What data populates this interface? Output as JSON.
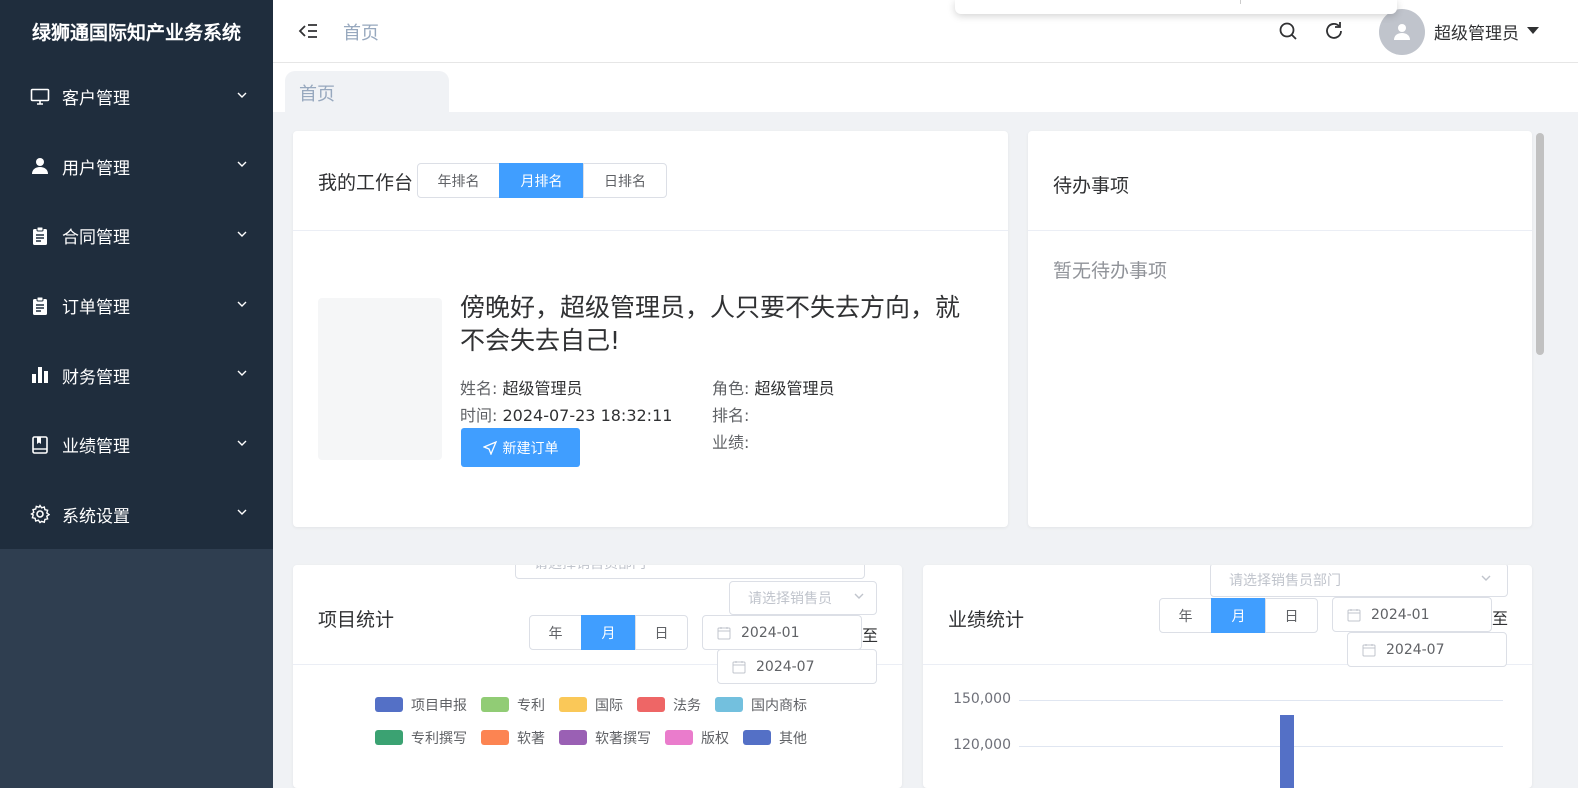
{
  "app": {
    "title": "绿狮通国际知产业务系统"
  },
  "sidebar": {
    "items": [
      {
        "label": "客户管理",
        "icon": "monitor-icon"
      },
      {
        "label": "用户管理",
        "icon": "user-icon"
      },
      {
        "label": "合同管理",
        "icon": "clipboard-icon"
      },
      {
        "label": "订单管理",
        "icon": "clipboard-icon"
      },
      {
        "label": "财务管理",
        "icon": "bar-chart-icon"
      },
      {
        "label": "业绩管理",
        "icon": "notebook-icon"
      },
      {
        "label": "系统设置",
        "icon": "gear-icon"
      }
    ]
  },
  "header": {
    "breadcrumb": "首页",
    "user": "超级管理员"
  },
  "tabs": [
    {
      "label": "首页"
    }
  ],
  "workbench": {
    "title": "我的工作台",
    "ranking_tabs": [
      "年排名",
      "月排名",
      "日排名"
    ],
    "active_tab": "月排名",
    "greeting": "傍晚好，超级管理员，人只要不失去方向，就不会失去自己!",
    "name_label": "姓名:",
    "name": "超级管理员",
    "time_label": "时间:",
    "time": "2024-07-23 18:32:11",
    "role_label": "角色:",
    "role": "超级管理员",
    "rank_label": "排名:",
    "rank": "",
    "performance_label": "业绩:",
    "performance": "",
    "new_order": "新建订单"
  },
  "todo": {
    "title": "待办事项",
    "empty": "暂无待办事项"
  },
  "project_stats": {
    "title": "项目统计",
    "period_tabs": [
      "年",
      "月",
      "日"
    ],
    "active_period": "月",
    "dept_placeholder": "请选择销售员部门",
    "sales_placeholder": "请选择销售员",
    "start_date": "2024-01",
    "to": "至",
    "end_date": "2024-07",
    "legend": [
      {
        "name": "项目申报",
        "color": "#5470c6"
      },
      {
        "name": "专利",
        "color": "#91cc75"
      },
      {
        "name": "国际",
        "color": "#fac858"
      },
      {
        "name": "法务",
        "color": "#ee6666"
      },
      {
        "name": "国内商标",
        "color": "#73c0de"
      },
      {
        "name": "专利撰写",
        "color": "#3ba272"
      },
      {
        "name": "软著",
        "color": "#fc8452"
      },
      {
        "name": "软著撰写",
        "color": "#9a60b4"
      },
      {
        "name": "版权",
        "color": "#ea7ccc"
      },
      {
        "name": "其他",
        "color": "#5470c6"
      }
    ]
  },
  "performance_stats": {
    "title": "业绩统计",
    "period_tabs": [
      "年",
      "月",
      "日"
    ],
    "active_period": "月",
    "dept_placeholder": "请选择销售员部门",
    "start_date": "2024-01",
    "to": "至",
    "end_date": "2024-07"
  },
  "chart_data": {
    "type": "bar",
    "y_ticks": [
      "150,000",
      "120,000"
    ],
    "series": [
      {
        "values": [
          140000
        ]
      }
    ]
  }
}
